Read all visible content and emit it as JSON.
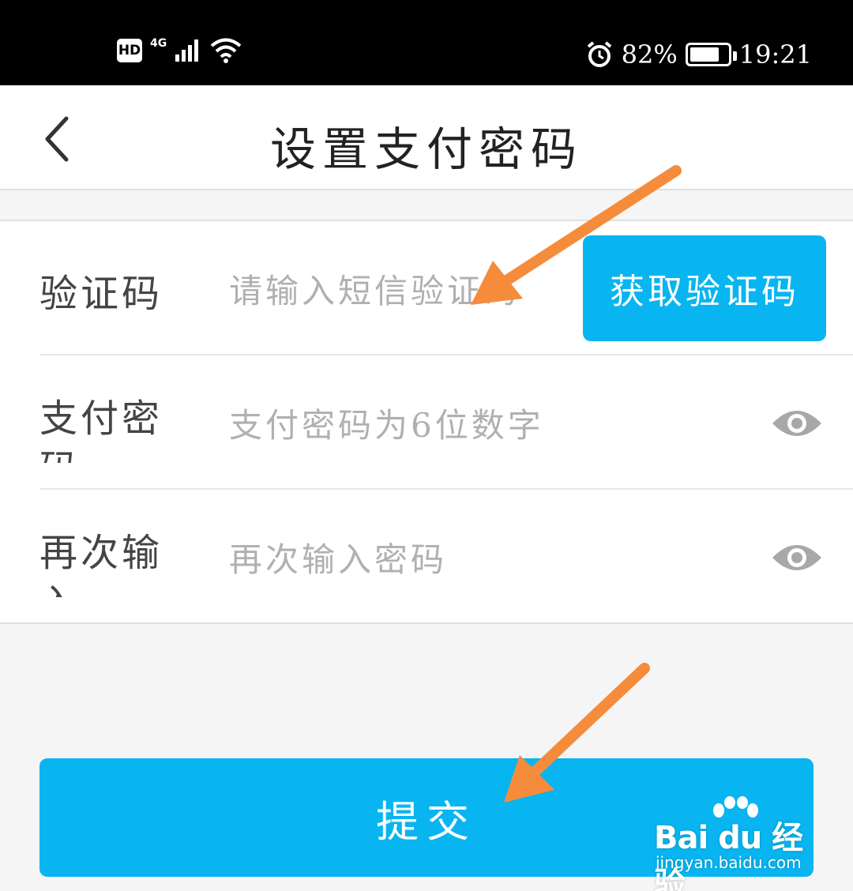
{
  "status_bar": {
    "hd_label": "HD",
    "network_label": "4G",
    "battery_percent": "82%",
    "battery_level": 0.82,
    "time": "19:21",
    "icons": [
      "signal-bars-icon",
      "wifi-icon",
      "alarm-icon",
      "battery-icon"
    ]
  },
  "header": {
    "title": "设置支付密码",
    "back_icon": "chevron-left-icon"
  },
  "form": {
    "verification": {
      "label": "验证码",
      "placeholder": "请输入短信验证码",
      "value": "",
      "button_label": "获取验证码"
    },
    "password": {
      "label": "支付密码",
      "placeholder": "支付密码为6位数字",
      "value": "",
      "toggle_icon": "eye-icon"
    },
    "confirm": {
      "label": "再次输入",
      "placeholder": "再次输入密码",
      "value": "",
      "toggle_icon": "eye-icon"
    }
  },
  "submit": {
    "label": "提交"
  },
  "watermark": {
    "brand": "Bai du 经验",
    "url": "jingyan.baidu.com"
  },
  "colors": {
    "accent": "#08b5f0",
    "arrow": "#f58c3c",
    "status_bar": "#000000"
  }
}
